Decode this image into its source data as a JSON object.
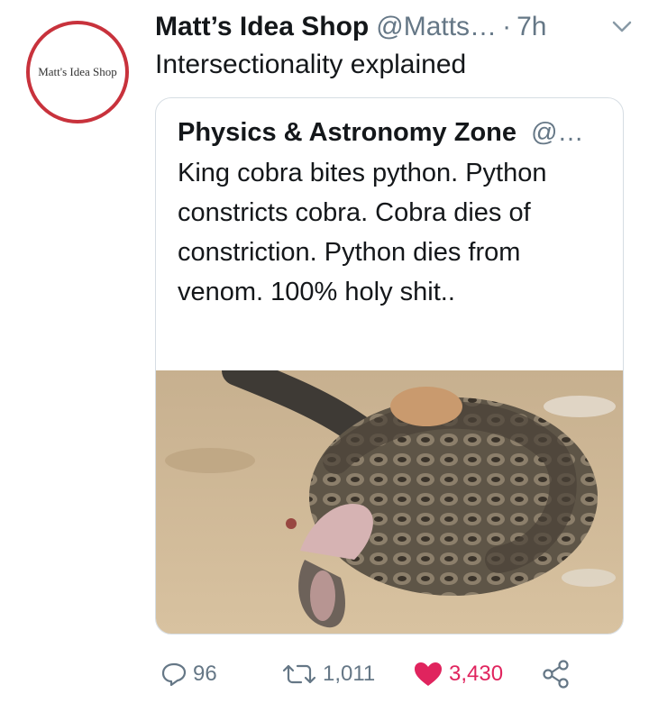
{
  "tweet": {
    "avatar_text": "Matt's Idea Shop",
    "author_name": "Matt’s Idea Shop",
    "handle": "@Matts…",
    "separator": "·",
    "time": "7h",
    "text": "Intersectionality explained",
    "caret_icon": "chevron-down-icon"
  },
  "quote": {
    "author_name": "Physics & Astronomy Zone",
    "handle": "@…",
    "text": "King cobra bites python. Python constricts cobra. Cobra dies of constriction. Python dies from venom. 100% holy shit..",
    "media_icon": "snake-photo"
  },
  "actions": {
    "reply_count": "96",
    "retweet_count": "1,011",
    "like_count": "3,430",
    "share_icon": "share-icon",
    "colors": {
      "muted": "#657786",
      "like": "#e0245e",
      "avatar_ring": "#c8323c"
    }
  }
}
